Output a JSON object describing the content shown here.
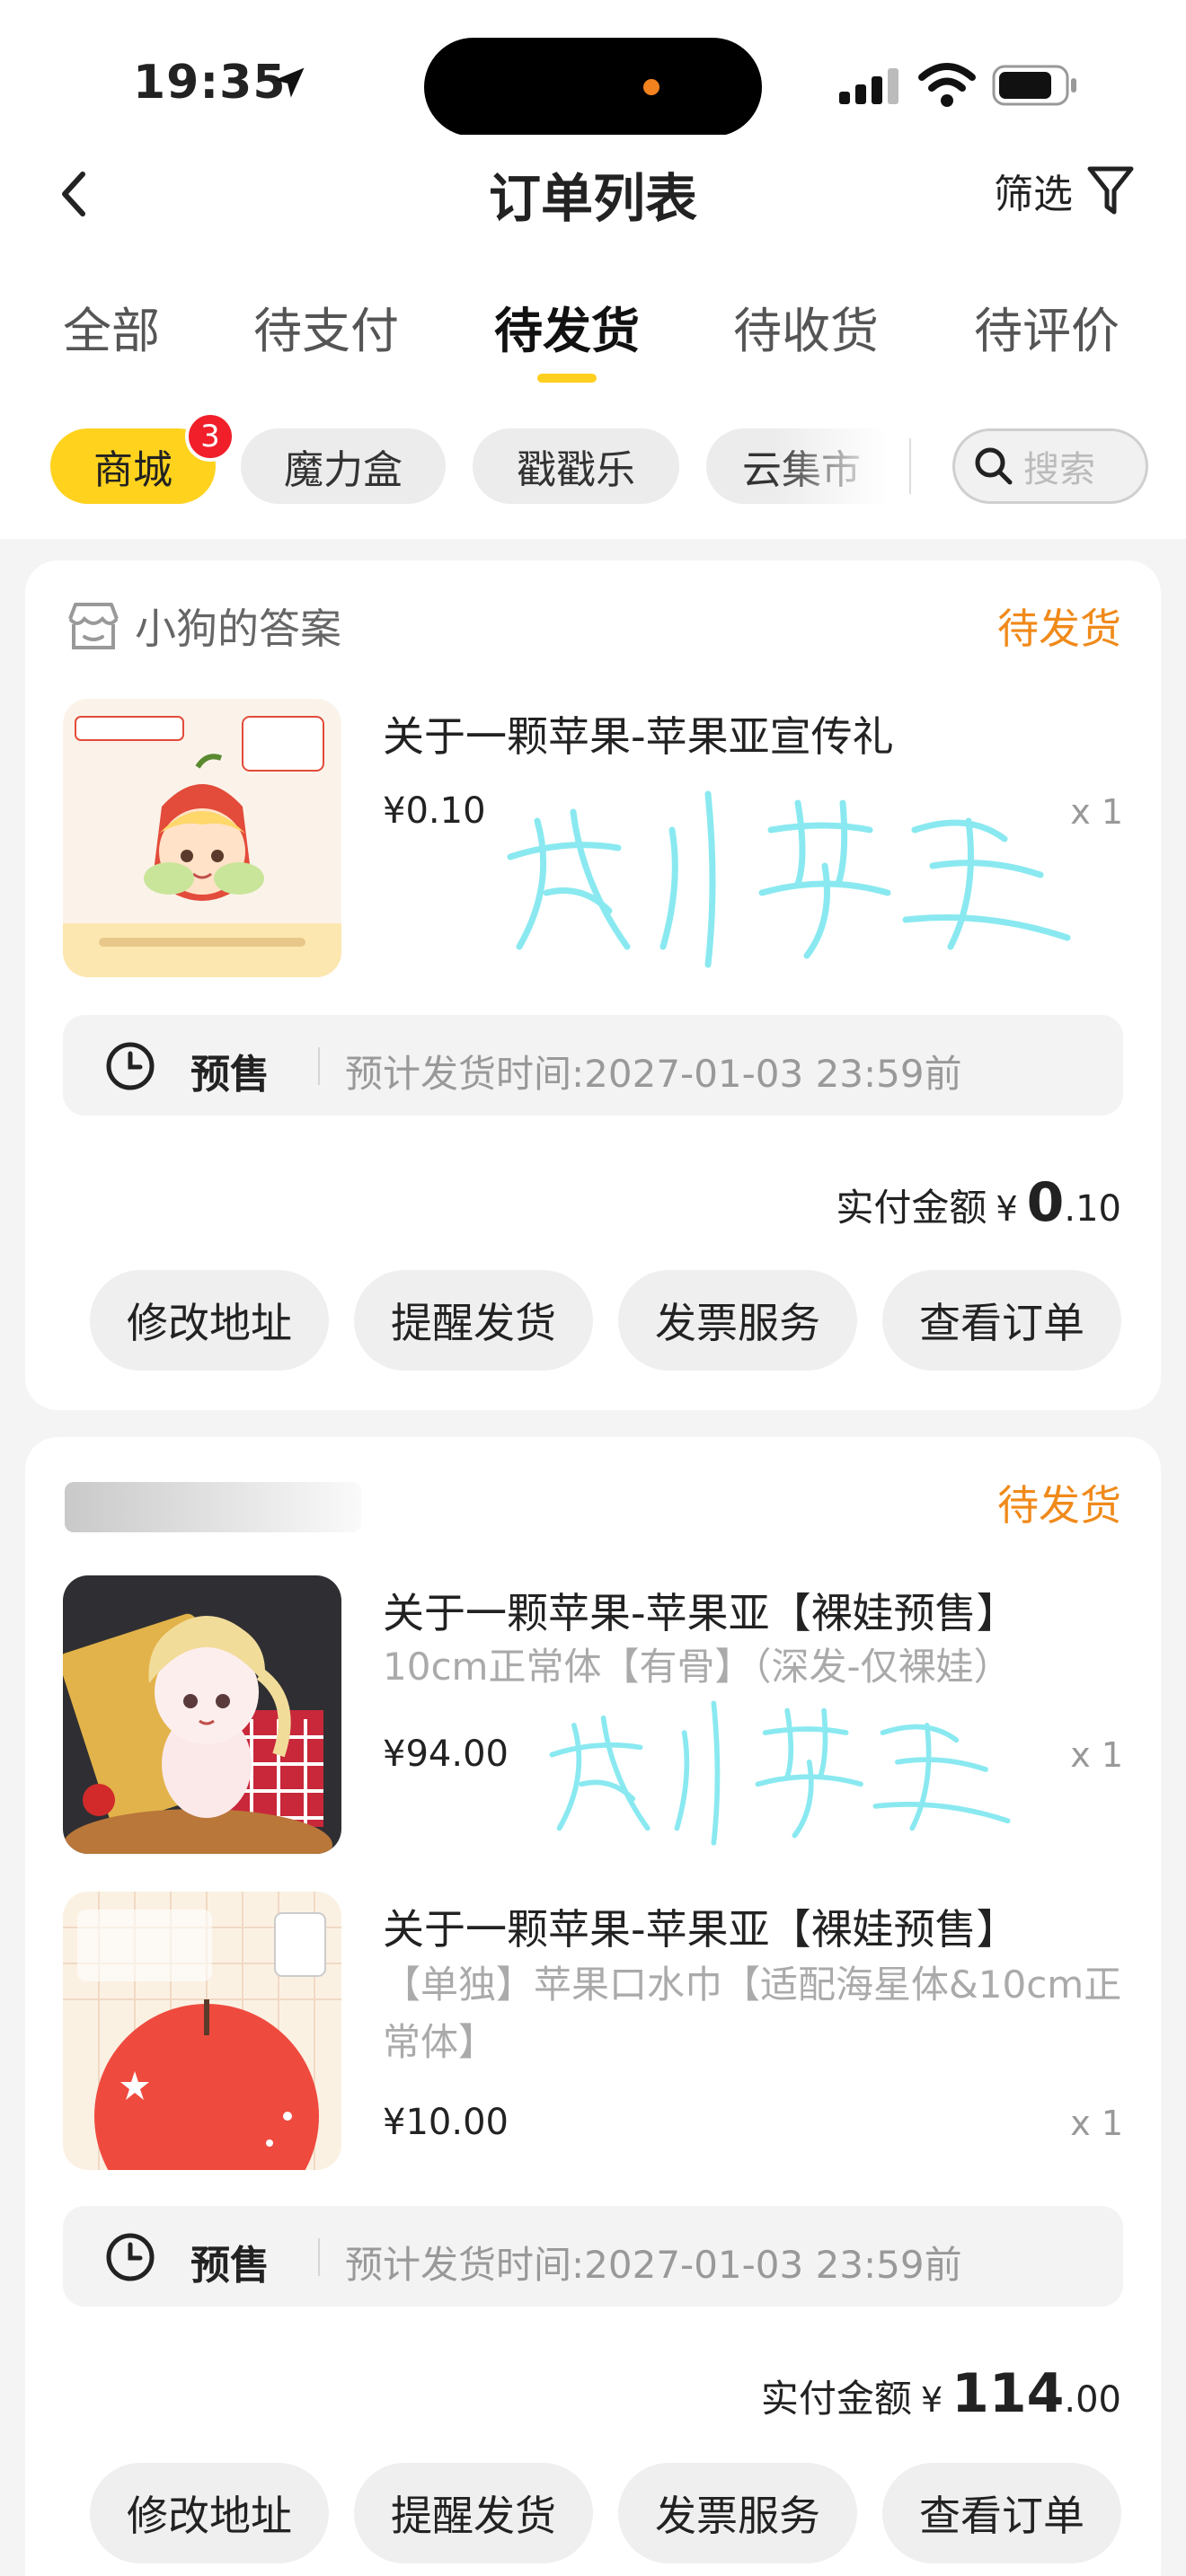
{
  "status_bar": {
    "time": "19:35"
  },
  "nav": {
    "title": "订单列表",
    "filter_label": "筛选"
  },
  "tabs": [
    {
      "label": "全部"
    },
    {
      "label": "待支付"
    },
    {
      "label": "待发货"
    },
    {
      "label": "待收货"
    },
    {
      "label": "待评价"
    }
  ],
  "active_tab": "待发货",
  "chips": [
    {
      "label": "商城",
      "badge": "3"
    },
    {
      "label": "魔力盒"
    },
    {
      "label": "戳戳乐"
    },
    {
      "label": "云集市"
    }
  ],
  "search": {
    "placeholder": "搜索"
  },
  "orders": [
    {
      "shop_name": "小狗的答案",
      "status": "待发货",
      "items": [
        {
          "title": "关于一颗苹果-苹果亚宣传礼",
          "price": "¥0.10",
          "qty": "x 1"
        }
      ],
      "presale": {
        "label": "预售",
        "text": "预计发货时间:2027-01-03 23:59前"
      },
      "paid": {
        "label": "实付金额",
        "currency": "¥",
        "integer": "0",
        "decimal": ".10"
      },
      "buttons": [
        "修改地址",
        "提醒发货",
        "发票服务",
        "查看订单"
      ]
    },
    {
      "status": "待发货",
      "items": [
        {
          "title": "关于一颗苹果-苹果亚【裸娃预售】",
          "spec": "10cm正常体【有骨】（深发-仅裸娃）",
          "price": "¥94.00",
          "qty": "x 1"
        },
        {
          "title": "关于一颗苹果-苹果亚【裸娃预售】",
          "spec": "【单独】苹果口水巾【适配海星体&10cm正常体】",
          "price": "¥10.00",
          "qty": "x 1"
        }
      ],
      "presale": {
        "label": "预售",
        "text": "预计发货时间:2027-01-03 23:59前"
      },
      "paid": {
        "label": "实付金额",
        "currency": "¥",
        "integer": "114",
        "decimal": ".00"
      },
      "buttons": [
        "修改地址",
        "提醒发货",
        "发票服务",
        "查看订单"
      ]
    }
  ],
  "colors": {
    "accent": "#ffd21e",
    "status_orange": "#f08a1a",
    "badge_red": "#f01f2a",
    "watermark": "#7fe8f0"
  }
}
